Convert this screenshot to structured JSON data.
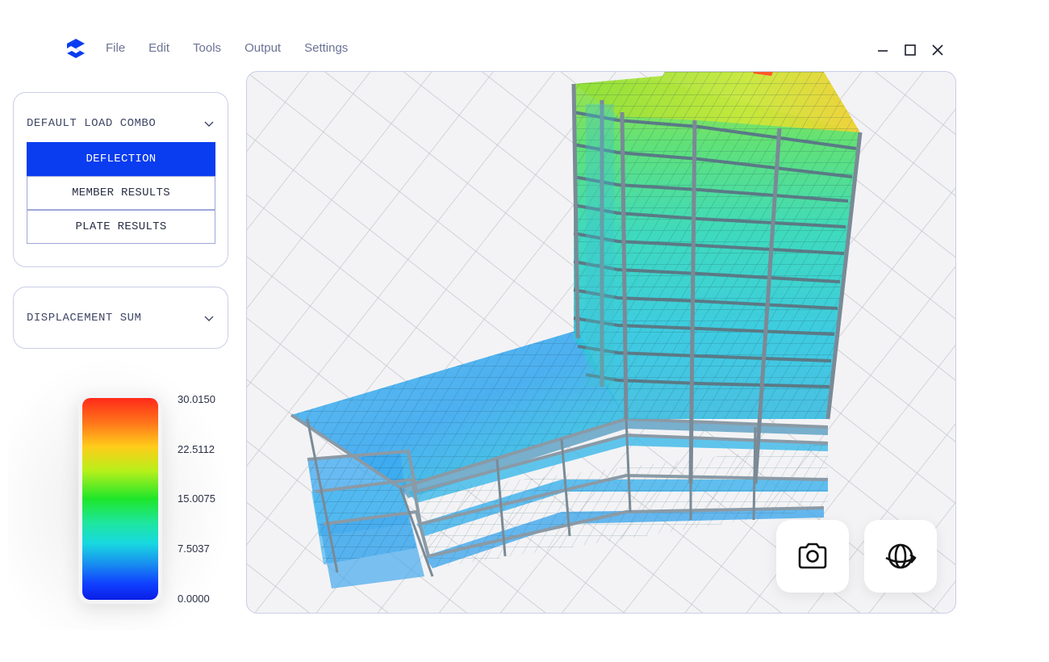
{
  "menu": {
    "items": [
      {
        "label": "File"
      },
      {
        "label": "Edit"
      },
      {
        "label": "Tools"
      },
      {
        "label": "Output"
      },
      {
        "label": "Settings"
      }
    ]
  },
  "window_controls": [
    "minimize-icon",
    "maximize-icon",
    "close-icon"
  ],
  "load_combo": {
    "selected": "DEFAULT LOAD COMBO",
    "results": [
      {
        "label": "DEFLECTION",
        "active": true
      },
      {
        "label": "MEMBER RESULTS",
        "active": false
      },
      {
        "label": "PLATE RESULTS",
        "active": false
      }
    ]
  },
  "result_type": {
    "selected": "DISPLACEMENT SUM"
  },
  "legend": {
    "ticks": [
      "30.0150",
      "22.5112",
      "15.0075",
      "7.5037",
      "0.0000"
    ],
    "colors": [
      "#ff2a1a",
      "#ffcc1a",
      "#1ee62a",
      "#18d8e0",
      "#0a1ee6"
    ]
  },
  "viewport": {
    "tools": [
      "camera-icon",
      "orbit-icon"
    ]
  },
  "colors": {
    "accent": "#0a3cf0",
    "border": "#c9cde8",
    "menu_text": "#6b7394"
  }
}
